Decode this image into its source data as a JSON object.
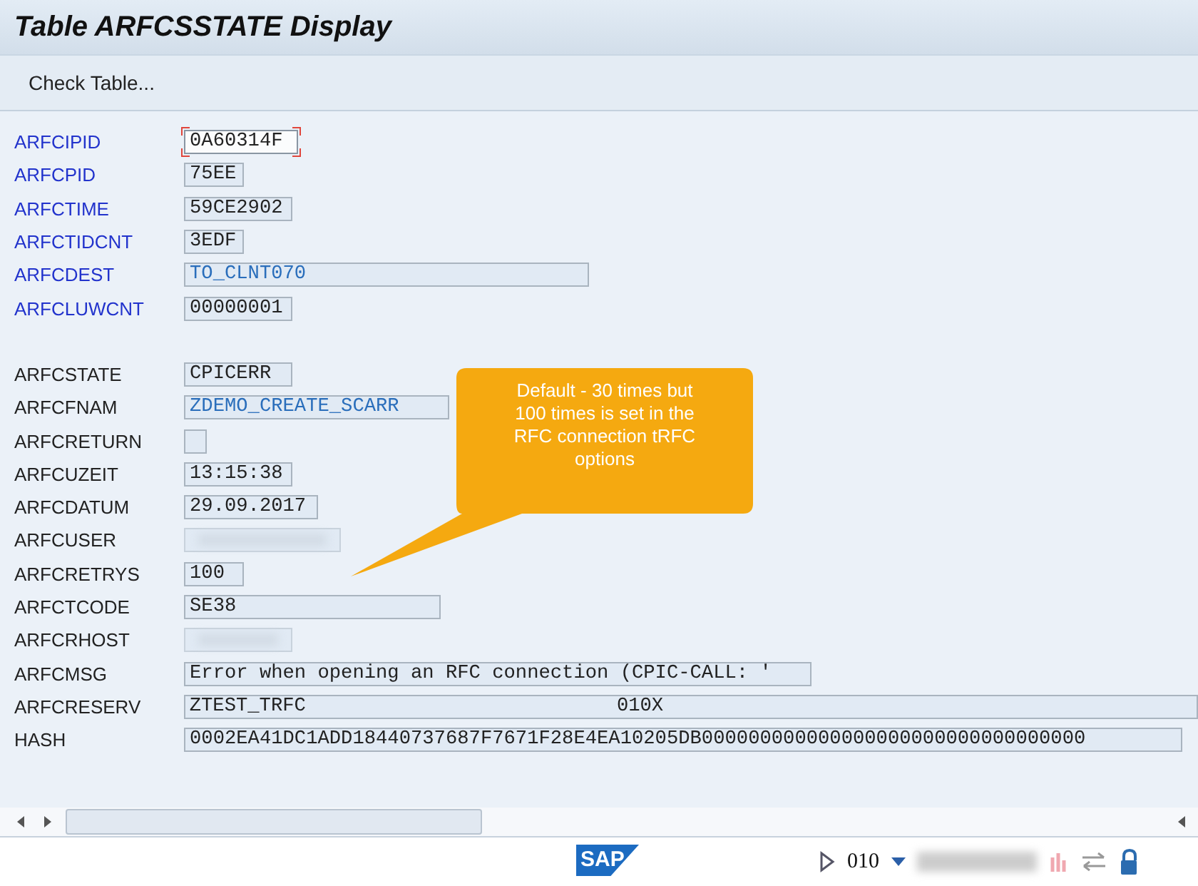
{
  "window": {
    "title": "Table ARFCSSTATE Display"
  },
  "toolbar": {
    "buttons": [
      "Check Table..."
    ]
  },
  "field_groups": [
    {
      "fields": [
        {
          "label": "ARFCIPID",
          "value": "0A60314F",
          "key": true,
          "kind": "field",
          "focused": true
        },
        {
          "label": "ARFCPID",
          "value": "75EE",
          "key": true,
          "kind": "field",
          "focused": false
        },
        {
          "label": "ARFCTIME",
          "value": "59CE2902",
          "key": true,
          "kind": "field",
          "focused": false
        },
        {
          "label": "ARFCTIDCNT",
          "value": "3EDF",
          "key": true,
          "kind": "field",
          "focused": false
        },
        {
          "label": "ARFCDEST",
          "value": "TO_CLNT070",
          "key": true,
          "kind": "link",
          "focused": false
        },
        {
          "label": "ARFCLUWCNT",
          "value": "00000001",
          "key": true,
          "kind": "field",
          "focused": false
        }
      ]
    },
    {
      "fields": [
        {
          "label": "ARFCSTATE",
          "value": "CPICERR",
          "key": false,
          "kind": "field",
          "focused": false
        },
        {
          "label": "ARFCFNAM",
          "value": "ZDEMO_CREATE_SCARR",
          "key": false,
          "kind": "link",
          "focused": false
        },
        {
          "label": "ARFCRETURN",
          "key": false,
          "kind": "field",
          "focused": false
        },
        {
          "label": "ARFCUZEIT",
          "value": "13:15:38",
          "key": false,
          "kind": "field",
          "focused": false
        },
        {
          "label": "ARFCDATUM",
          "value": "29.09.2017",
          "key": false,
          "kind": "field",
          "focused": false
        },
        {
          "label": "ARFCUSER",
          "key": false,
          "kind": "redacted",
          "focused": false
        },
        {
          "label": "ARFCRETRYS",
          "value": "100",
          "key": false,
          "kind": "field",
          "focused": false
        },
        {
          "label": "ARFCTCODE",
          "value": "SE38",
          "key": false,
          "kind": "field",
          "focused": false
        },
        {
          "label": "ARFCRHOST",
          "key": false,
          "kind": "redacted",
          "focused": false
        },
        {
          "label": "ARFCMSG",
          "value": "Error when opening an RFC connection (CPIC-CALL: '",
          "key": false,
          "kind": "field",
          "focused": false
        },
        {
          "label": "ARFCRESERV",
          "value": "ZTEST_TRFC",
          "value_2": "010X",
          "key": false,
          "kind": "field",
          "focused": false
        },
        {
          "label": "HASH",
          "value": "0002EA41DC1ADD18440737687F7671F28E4EA10205DB000000000000000000000000000000000",
          "key": false,
          "kind": "field",
          "focused": false
        }
      ]
    }
  ],
  "callout": {
    "text": "Default - 30 times but 100 times is set in the RFC connection tRFC options"
  },
  "status_bar": {
    "logo": "SAP",
    "client": "010"
  }
}
